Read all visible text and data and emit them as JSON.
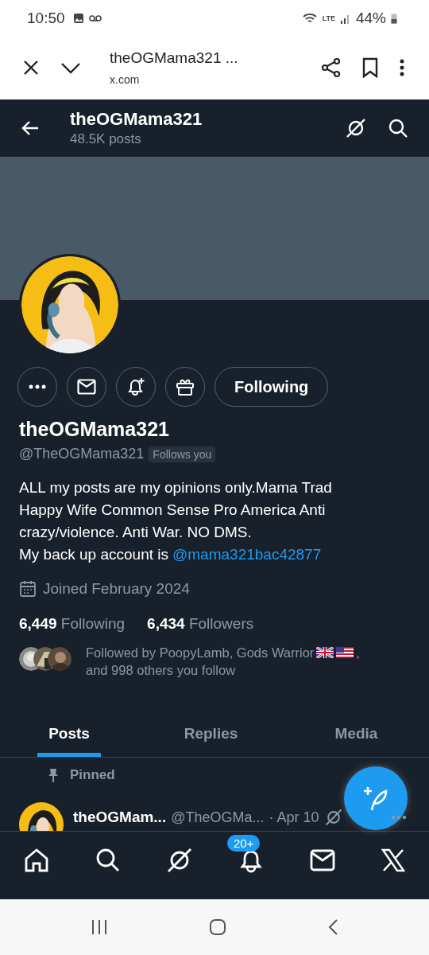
{
  "status_bar": {
    "time": "10:50",
    "battery": "44%",
    "network": "LTE"
  },
  "browser_bar": {
    "title": "theOGMama321 ...",
    "url": "x.com"
  },
  "header": {
    "name": "theOGMama321",
    "posts": "48.5K posts"
  },
  "profile": {
    "action_buttons": [
      {
        "kind": "more"
      },
      {
        "kind": "message"
      },
      {
        "kind": "notify"
      },
      {
        "kind": "gift"
      }
    ],
    "follow_button": "Following",
    "name": "theOGMama321",
    "handle": "@TheOGMama321",
    "follows_you": "Follows you",
    "bio": [
      "ALL my posts are my opinions only.Mama Trad Happy Wife Common Sense Pro America Anti crazy/violence. Anti War.  NO DMS."
    ],
    "bio_link_prefix": "My back up account is",
    "bio_link": "@mama321bac42877",
    "joined": "Joined February 2024",
    "following_count": "6,449",
    "following_label": "Following",
    "followers_count": "6,434",
    "followers_label": "Followers",
    "followed_by": {
      "line1": "Followed by PoopyLamb, Gods Warrior",
      "line1_end": ",",
      "line2": "and 998 others you follow"
    }
  },
  "tabs": [
    {
      "label": "Posts",
      "selected": true
    },
    {
      "label": "Replies",
      "selected": false
    },
    {
      "label": "Media",
      "selected": false
    }
  ],
  "pinned_post": {
    "label": "Pinned",
    "name": "theOGMam...",
    "handle": "@TheOGMa...",
    "date": "· Apr 10"
  },
  "bottom_nav": [
    {
      "kind": "home"
    },
    {
      "kind": "search"
    },
    {
      "kind": "grok"
    },
    {
      "kind": "notifications",
      "badge": "20+"
    },
    {
      "kind": "messages"
    },
    {
      "kind": "x"
    }
  ]
}
